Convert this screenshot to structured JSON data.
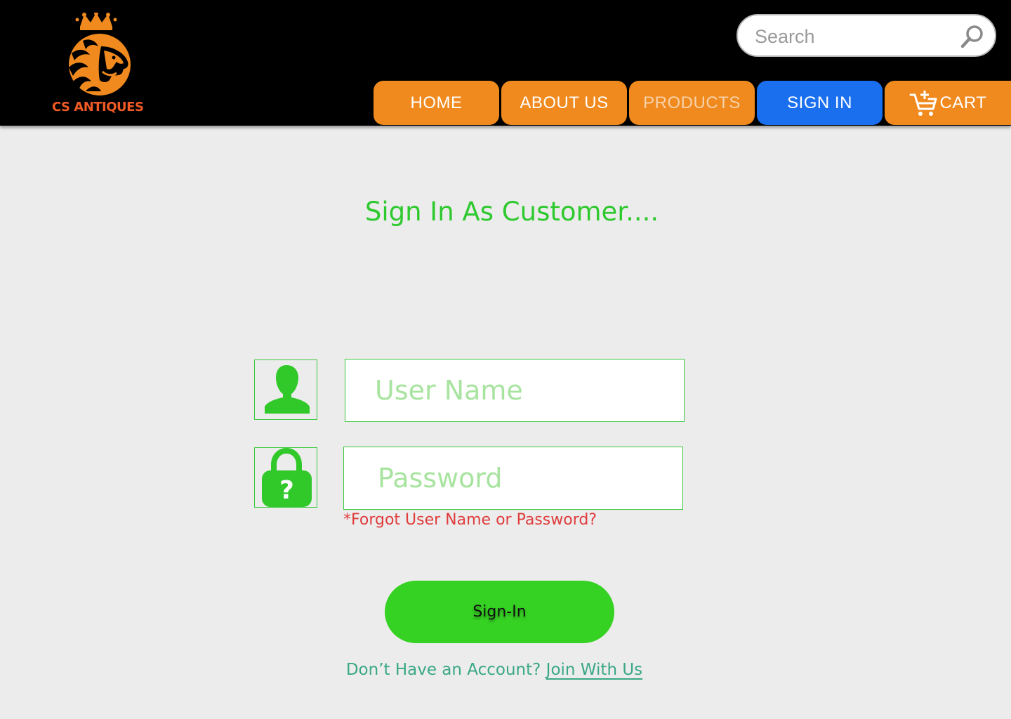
{
  "brand": {
    "name": "CS ANTIQUES",
    "logo_icon": "crowned-lion-icon",
    "accent_color": "#f08a1e",
    "logo_text_color": "#f15a24"
  },
  "search": {
    "placeholder": "Search",
    "value": "",
    "icon": "search-icon"
  },
  "nav": {
    "home": "HOME",
    "about": "ABOUT US",
    "products": "PRODUCTS",
    "signin": "SIGN IN",
    "cart": "CART",
    "cart_icon": "add-to-cart-icon",
    "active": "SIGN IN",
    "active_color": "#1a6fef"
  },
  "main": {
    "title": "Sign In As Customer....",
    "username": {
      "placeholder": "User Name",
      "value": "",
      "icon": "user-icon"
    },
    "password": {
      "placeholder": "Password",
      "value": "",
      "icon": "lock-question-icon"
    },
    "forgot_link": "*Forgot User Name or Password?",
    "submit_label": "Sign-In",
    "no_account_text": "Don’t Have an Account?",
    "join_link": "Join With Us",
    "primary_color": "#36d223"
  }
}
